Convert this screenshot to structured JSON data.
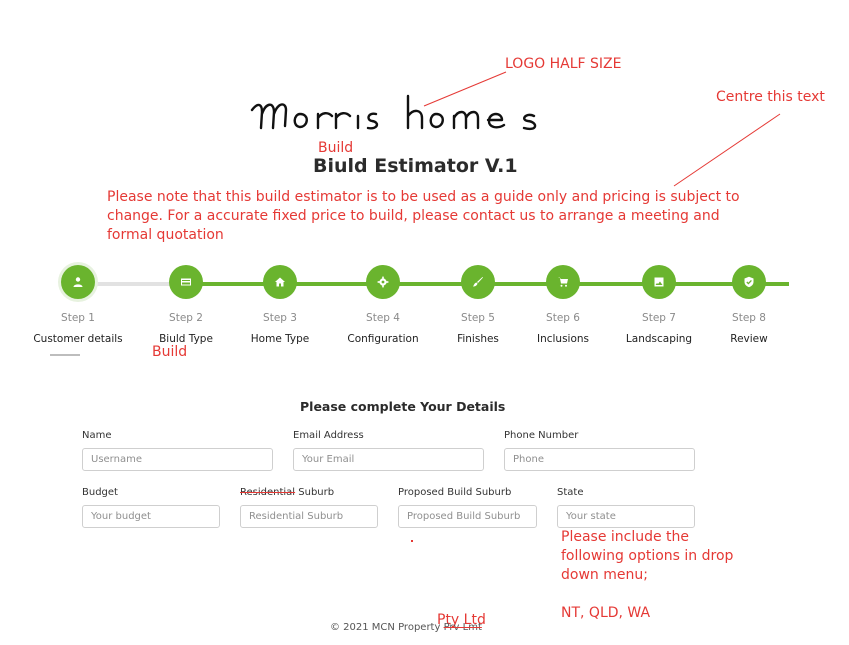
{
  "annotations": {
    "logo_note": "LOGO HALF SIZE",
    "centre_note": "Centre this text",
    "build_above_title": "Build",
    "build_under_step2": "Build",
    "state_note_lines": [
      "Please include the",
      "following options in drop",
      "down menu;",
      "",
      "NT, QLD, WA"
    ],
    "footer_correction": "Pty Ltd",
    "accent_color": "#e53935"
  },
  "logo": {
    "text": "morris homes"
  },
  "title": "Biuld Estimator V.1",
  "notice": "Please note that this build estimator is to be used as a guide only and pricing is subject to change. For a accurate fixed price to build, please contact us to arrange a meeting and formal quotation",
  "stepper": {
    "color": "#6ab42e",
    "steps": [
      {
        "num": "Step 1",
        "label": "Customer details",
        "icon": "user-icon"
      },
      {
        "num": "Step 2",
        "label": "Biuld Type",
        "icon": "card-icon"
      },
      {
        "num": "Step 3",
        "label": "Home Type",
        "icon": "home-icon"
      },
      {
        "num": "Step 4",
        "label": "Configuration",
        "icon": "gear-icon"
      },
      {
        "num": "Step 5",
        "label": "Finishes",
        "icon": "brush-icon"
      },
      {
        "num": "Step 6",
        "label": "Inclusions",
        "icon": "cart-icon"
      },
      {
        "num": "Step 7",
        "label": "Landscaping",
        "icon": "image-icon"
      },
      {
        "num": "Step 8",
        "label": "Review",
        "icon": "shield-check-icon"
      }
    ]
  },
  "form": {
    "title": "Please complete Your Details",
    "name": {
      "label": "Name",
      "placeholder": "Username"
    },
    "email": {
      "label": "Email Address",
      "placeholder": "Your Email"
    },
    "phone": {
      "label": "Phone Number",
      "placeholder": "Phone"
    },
    "budget": {
      "label": "Budget",
      "placeholder": "Your budget"
    },
    "suburb": {
      "label_struck": "Residential",
      "label_rest": " Suburb",
      "placeholder": "Residential Suburb"
    },
    "build_suburb": {
      "label": "Proposed Build Suburb",
      "placeholder": "Proposed Build Suburb"
    },
    "state": {
      "label": "State",
      "placeholder": "Your state"
    }
  },
  "footer": {
    "prefix": "© 2021 MCN Property ",
    "struck": "Prv Lmt"
  }
}
